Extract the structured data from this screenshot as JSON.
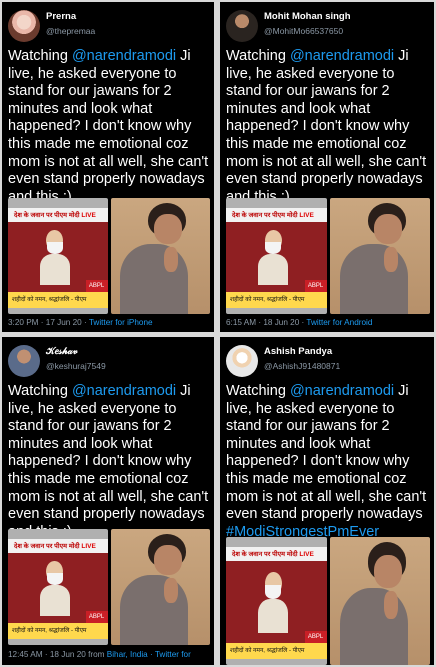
{
  "tweets": [
    {
      "display_name": "Prerna",
      "handle": "@thepremaa",
      "text_before": "Watching ",
      "mention": "@narendramodi",
      "text_after": " Ji live, he asked everyone to stand for our jawans for 2 minutes and look what happened? I don't know why this made me emotional coz mom is not at all well, she can't even stand properly nowadays and this :)",
      "timestamp": "3:20 PM · 17 Jun 20 · ",
      "source": "Twitter for iPhone",
      "tv_caption": "देश के जवान पर पीएम मोदी",
      "tv_live": "LIVE",
      "ticker": "शहीदों को नमन, श्रद्धांजलि - पीएम",
      "brand": "ABPL"
    },
    {
      "display_name": "Mohit Mohan singh",
      "handle": "@MohitMo66537650",
      "text_before": "Watching ",
      "mention": "@narendramodi",
      "text_after": " Ji live, he asked everyone to stand for our jawans for 2 minutes and look what happened? I don't know why this made me emotional coz mom is not at all well, she can't even stand properly nowadays and this :)",
      "timestamp": "6:15 AM · 18 Jun 20 · ",
      "source": "Twitter for Android",
      "tv_caption": "देश के जवान पर पीएम मोदी",
      "tv_live": "LIVE",
      "ticker": "शहीदों को नमन, श्रद्धांजलि - पीएम",
      "brand": "ABPL"
    },
    {
      "display_name": "𝒦𝑒𝓈𝒽𝒶𝓋",
      "handle": "@keshuraj7549",
      "text_before": "Watching ",
      "mention": "@narendramodi",
      "text_after": " Ji live, he asked everyone to stand for our jawans for 2 minutes and look what happened? I don't know why this made me emotional coz mom is not at all well, she can't even stand properly nowadays and this :)",
      "timestamp": "12:45 AM · 18 Jun 20 from ",
      "location": "Bihar, India",
      "source": " · Twitter for",
      "tv_caption": "देश के जवान पर पीएम मोदी",
      "tv_live": "LIVE",
      "ticker": "शहीदों को नमन, श्रद्धांजलि - पीएम",
      "brand": "ABPL"
    },
    {
      "display_name": "Ashish Pandya",
      "handle": "@AshishJ91480871",
      "text_before": "Watching ",
      "mention": "@narendramodi",
      "text_after": " Ji live, he asked everyone to stand for our jawans for 2 minutes and look what happened? I don't know why this made me emotional coz mom is not at all well, she can't even stand properly nowadays ",
      "hashtag": "#ModiStrongestPmEver",
      "tv_caption": "देश के जवान पर पीएम मोदी",
      "tv_live": "LIVE",
      "ticker": "शहीदों को नमन, श्रद्धांजलि - पीएम",
      "brand": "ABPL"
    }
  ],
  "colors": {
    "link": "#1d9bf0",
    "muted": "#8b98a5",
    "background": "#000000"
  }
}
